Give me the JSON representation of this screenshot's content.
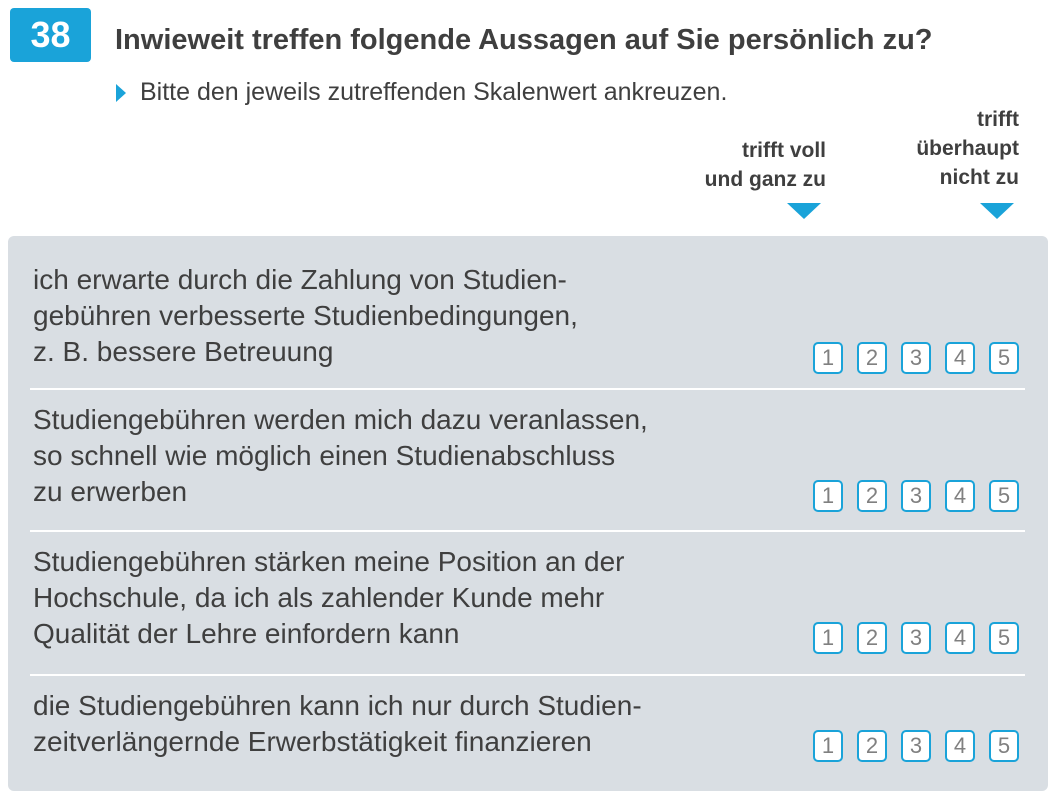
{
  "question": {
    "number": "38",
    "title": "Inwieweit treffen folgende Aussagen auf Sie persönlich zu?",
    "instruction": "Bitte den jeweils zutreffenden Skalenwert ankreuzen."
  },
  "scale": {
    "left_label": "trifft voll\nund ganz zu",
    "right_label": "trifft\nüberhaupt\nnicht zu",
    "options": [
      "1",
      "2",
      "3",
      "4",
      "5"
    ],
    "accent_color": "#1aa3d9"
  },
  "items": [
    {
      "text": "ich erwarte durch die Zahlung von Studien-\ngebühren verbesserte Studienbedingungen,\nz. B. bessere Betreuung"
    },
    {
      "text": "Studiengebühren werden mich dazu veranlassen,\nso schnell wie möglich einen Studienabschluss\nzu erwerben"
    },
    {
      "text": "Studiengebühren stärken meine Position an der\nHochschule, da ich als zahlender Kunde mehr\nQualität der Lehre einfordern kann"
    },
    {
      "text": "die Studiengebühren kann ich nur durch Studien-\nzeitverlängernde Erwerbstätigkeit finanzieren"
    }
  ]
}
